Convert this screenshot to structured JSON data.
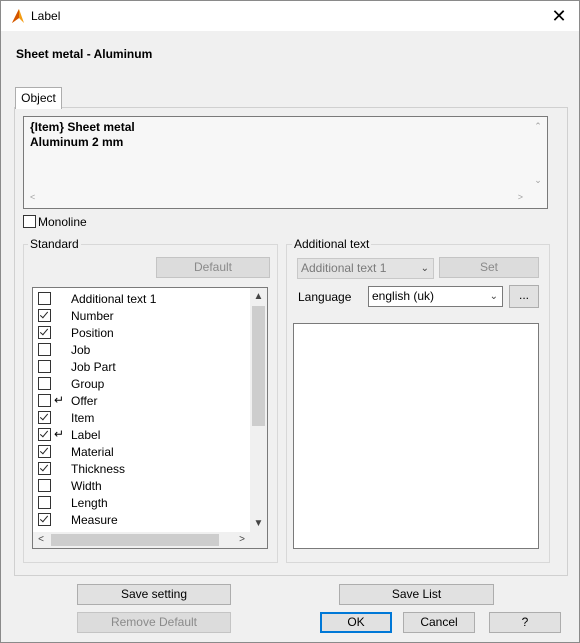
{
  "window": {
    "title": "Label",
    "close_symbol": "✕"
  },
  "heading": "Sheet metal - Aluminum",
  "tabs": [
    {
      "label": "Object"
    }
  ],
  "object_text": {
    "line1": "{Item} Sheet metal",
    "line2": "Aluminum 2 mm"
  },
  "monoline": {
    "label": "Monoline",
    "checked": false
  },
  "standard": {
    "label": "Standard",
    "default_button": "Default",
    "items": [
      {
        "label": "Additional text 1",
        "checked": false,
        "arrow": false
      },
      {
        "label": "Number",
        "checked": true,
        "arrow": false
      },
      {
        "label": "Position",
        "checked": true,
        "arrow": false
      },
      {
        "label": "Job",
        "checked": false,
        "arrow": false
      },
      {
        "label": "Job Part",
        "checked": false,
        "arrow": false
      },
      {
        "label": "Group",
        "checked": false,
        "arrow": false
      },
      {
        "label": "Offer",
        "checked": false,
        "arrow": true
      },
      {
        "label": "Item",
        "checked": true,
        "arrow": false
      },
      {
        "label": "Label",
        "checked": true,
        "arrow": true
      },
      {
        "label": "Material",
        "checked": true,
        "arrow": false
      },
      {
        "label": "Thickness",
        "checked": true,
        "arrow": false
      },
      {
        "label": "Width",
        "checked": false,
        "arrow": false
      },
      {
        "label": "Length",
        "checked": false,
        "arrow": false
      },
      {
        "label": "Measure",
        "checked": true,
        "arrow": false
      }
    ]
  },
  "additional": {
    "label": "Additional text",
    "select_value": "Additional text 1",
    "set_button": "Set",
    "language_label": "Language",
    "language_value": "english (uk)",
    "ellipsis_button": "..."
  },
  "buttons": {
    "save_setting": "Save setting",
    "save_list": "Save List",
    "remove_default": "Remove Default",
    "ok": "OK",
    "cancel": "Cancel",
    "help": "?"
  }
}
